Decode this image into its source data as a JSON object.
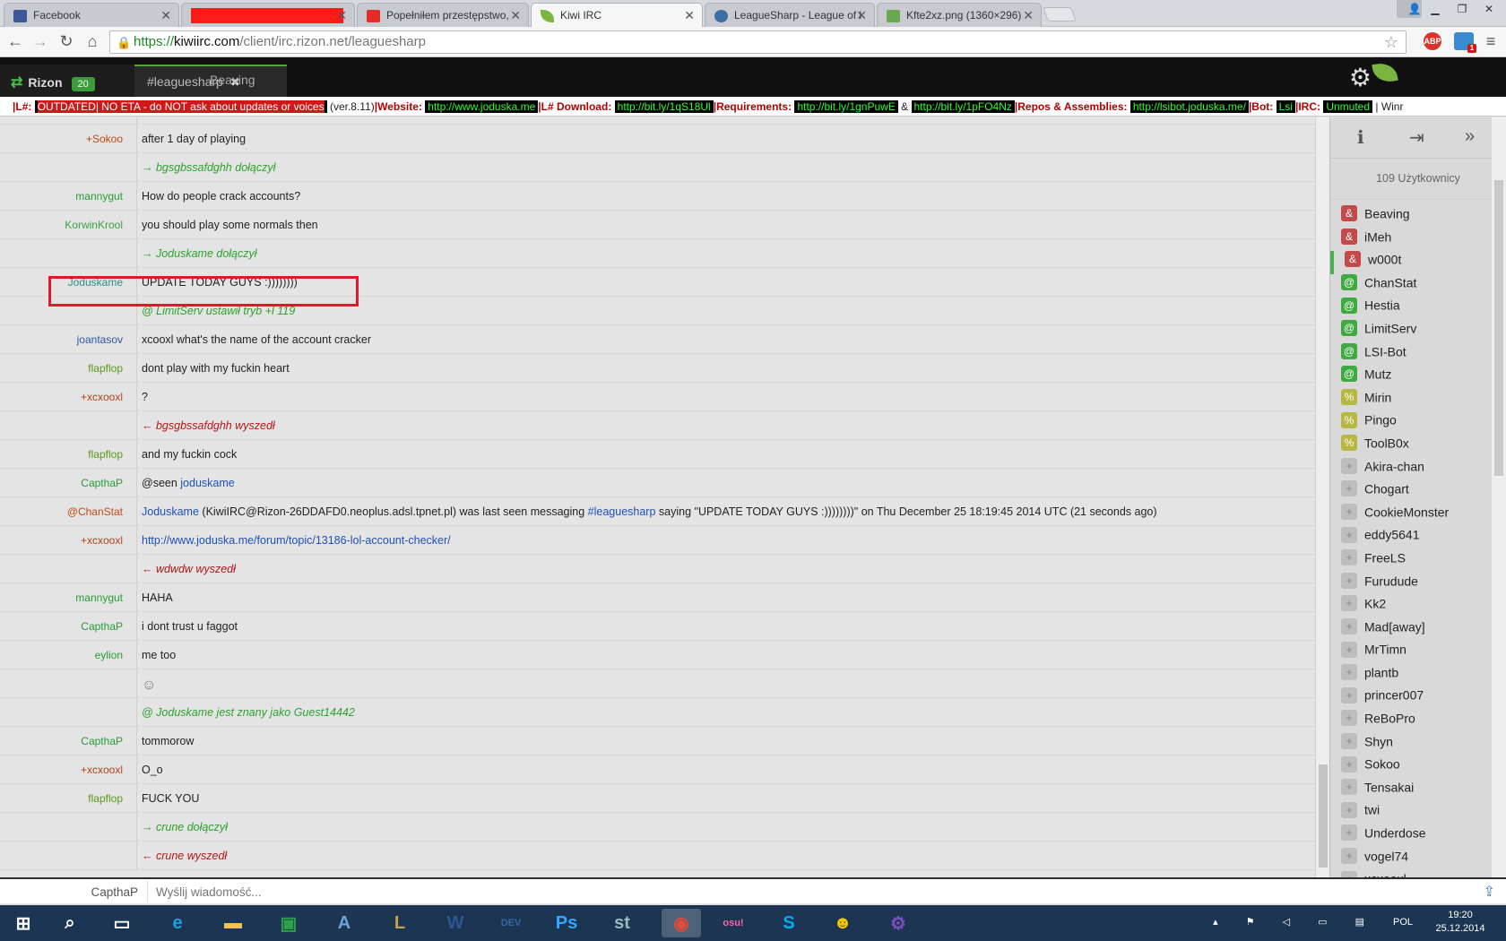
{
  "browser": {
    "tabs": [
      {
        "label": "Facebook",
        "favicon_color": "#3b5998"
      },
      {
        "label": "",
        "favicon_color": "#ff1a1a"
      },
      {
        "label": "Popełniłem przestępstwo,",
        "favicon_color": "#e52d27"
      },
      {
        "label": "Kiwi IRC",
        "favicon_color": "#7ab542"
      },
      {
        "label": "LeagueSharp - League of l",
        "favicon_color": "#3c6ea2"
      },
      {
        "label": "Kfte2xz.png (1360×296)",
        "favicon_color": "#6aa84f"
      }
    ],
    "url_https": "https://",
    "url_host": "kiwiirc.com",
    "url_path": "/client/irc.rizon.net/leaguesharp",
    "ext_abp": "ABP",
    "ext_badge": "1"
  },
  "kiwi": {
    "network": "Rizon",
    "network_badge": "20",
    "channel": "#leaguesharp",
    "query": "Beaving"
  },
  "topic": {
    "prefix": "|L#: ",
    "outdated": "OUTDATED| NO ETA - do NOT ask about updates or voices",
    "version": " (ver.8.11)",
    "website_label": "|Website: ",
    "website": "http://www.joduska.me",
    "download_label": "|L# Download: ",
    "download": "http://bit.ly/1qS18Ul",
    "req_label": "|Requirements: ",
    "req1": "http://bit.ly/1gnPuwE",
    "amp": " & ",
    "req2": "http://bit.ly/1pFO4Nz",
    "repos_label": "|Repos & Assemblies: ",
    "repos": "http://lsibot.joduska.me/",
    "bot_label": "|Bot: ",
    "bot": "Lsi",
    "irc_label": "|IRC: ",
    "irc": "Unmuted",
    "tail": " | Winr"
  },
  "messages": [
    {
      "nick": "",
      "text": "",
      "nick_color": "#c04a14",
      "kind": "normal"
    },
    {
      "nick": "+Sokoo",
      "text": "after 1 day of playing",
      "nick_color": "#c04a14",
      "kind": "normal"
    },
    {
      "nick": "",
      "text": "→ bgsgbssafdghh dołączył",
      "nick_color": "#2ea02e",
      "kind": "join"
    },
    {
      "nick": "mannygut",
      "text": "How do people crack accounts?",
      "nick_color": "#2b9a3b",
      "kind": "normal"
    },
    {
      "nick": "KorwinKrool",
      "text": "you should play some normals then",
      "nick_color": "#3aa24a",
      "kind": "normal"
    },
    {
      "nick": "",
      "text": "→ Joduskame dołączył",
      "nick_color": "#2ea02e",
      "kind": "join"
    },
    {
      "nick": "Joduskame",
      "text": "UPDATE TODAY GUYS :))))))))",
      "nick_color": "#2a8f84",
      "kind": "normal"
    },
    {
      "nick": "",
      "text": "@ LimitServ ustawił tryb +l 119",
      "nick_color": "#2ea02e",
      "kind": "join"
    },
    {
      "nick": "joantasov",
      "text": "xcooxl what's the name of the account cracker",
      "nick_color": "#2e55a8",
      "kind": "normal"
    },
    {
      "nick": "flapflop",
      "text": "dont play with my fuckin heart",
      "nick_color": "#5a9a18",
      "kind": "normal"
    },
    {
      "nick": "+xcxooxl",
      "text": "?",
      "nick_color": "#b0411e",
      "kind": "normal"
    },
    {
      "nick": "",
      "text": "← bgsgbssafdghh wyszedł",
      "nick_color": "#b01818",
      "kind": "part"
    },
    {
      "nick": "flapflop",
      "text": "and my fuckin cock",
      "nick_color": "#5a9a18",
      "kind": "normal"
    },
    {
      "nick": "CapthaP",
      "text": "@seen ",
      "text_link": "joduskame",
      "nick_color": "#2b9a3b",
      "kind": "normal"
    },
    {
      "nick": "@ChanStat",
      "text": "",
      "nick_color": "#c04a14",
      "kind": "chanstat"
    },
    {
      "nick": "+xcxooxl",
      "text": "",
      "text_link": "http://www.joduska.me/forum/topic/13186-lol-account-checker/",
      "nick_color": "#b0411e",
      "kind": "normal"
    },
    {
      "nick": "",
      "text": "← wdwdw wyszedł",
      "nick_color": "#b01818",
      "kind": "part"
    },
    {
      "nick": "mannygut",
      "text": "HAHA",
      "nick_color": "#2b9a3b",
      "kind": "normal"
    },
    {
      "nick": "CapthaP",
      "text": "i dont trust u faggot",
      "nick_color": "#2b9a3b",
      "kind": "normal"
    },
    {
      "nick": "eylion",
      "text": "me too",
      "nick_color": "#2b9a3b",
      "kind": "normal"
    },
    {
      "nick": "",
      "text": "☺",
      "nick_color": "#777",
      "kind": "emoji"
    },
    {
      "nick": "",
      "text": "@ Joduskame jest znany jako Guest14442",
      "nick_color": "#2ea02e",
      "kind": "join"
    },
    {
      "nick": "CapthaP",
      "text": "tommorow",
      "nick_color": "#2b9a3b",
      "kind": "normal"
    },
    {
      "nick": "+xcxooxl",
      "text": "O_o",
      "nick_color": "#b0411e",
      "kind": "normal"
    },
    {
      "nick": "flapflop",
      "text": "FUCK YOU",
      "nick_color": "#5a9a18",
      "kind": "normal"
    },
    {
      "nick": "",
      "text": "→ crune dołączył",
      "nick_color": "#2ea02e",
      "kind": "join"
    },
    {
      "nick": "",
      "text": "← crune wyszedł",
      "nick_color": "#b01818",
      "kind": "part"
    }
  ],
  "chanstat": {
    "nick_link": "Joduskame",
    "middle": " (KiwiIRC@Rizon-26DDAFD0.neoplus.adsl.tpnet.pl) was last seen messaging ",
    "chan_link": "#leaguesharp",
    "end": " saying \"UPDATE TODAY GUYS :))))))))\" on Thu December 25 18:19:45 2014 UTC (21 seconds ago)"
  },
  "sidebar": {
    "user_count": "109 Użytkownicy",
    "users": [
      {
        "mode": "&",
        "name": "Beaving",
        "cls": "owner"
      },
      {
        "mode": "&",
        "name": "iMeh",
        "cls": "owner"
      },
      {
        "mode": "&",
        "name": "w000t",
        "cls": "owner"
      },
      {
        "mode": "@",
        "name": "ChanStat",
        "cls": "op"
      },
      {
        "mode": "@",
        "name": "Hestia",
        "cls": "op"
      },
      {
        "mode": "@",
        "name": "LimitServ",
        "cls": "op"
      },
      {
        "mode": "@",
        "name": "LSI-Bot",
        "cls": "op"
      },
      {
        "mode": "@",
        "name": "Mutz",
        "cls": "op"
      },
      {
        "mode": "%",
        "name": "Mirin",
        "cls": "halfop"
      },
      {
        "mode": "%",
        "name": "Pingo",
        "cls": "halfop"
      },
      {
        "mode": "%",
        "name": "ToolB0x",
        "cls": "halfop"
      },
      {
        "mode": "+",
        "name": "Akira-chan",
        "cls": "voice"
      },
      {
        "mode": "+",
        "name": "Chogart",
        "cls": "voice"
      },
      {
        "mode": "+",
        "name": "CookieMonster",
        "cls": "voice"
      },
      {
        "mode": "+",
        "name": "eddy5641",
        "cls": "voice"
      },
      {
        "mode": "+",
        "name": "FreeLS",
        "cls": "voice"
      },
      {
        "mode": "+",
        "name": "Furudude",
        "cls": "voice"
      },
      {
        "mode": "+",
        "name": "Kk2",
        "cls": "voice"
      },
      {
        "mode": "+",
        "name": "Mad[away]",
        "cls": "voice"
      },
      {
        "mode": "+",
        "name": "MrTimn",
        "cls": "voice"
      },
      {
        "mode": "+",
        "name": "plantb",
        "cls": "voice"
      },
      {
        "mode": "+",
        "name": "princer007",
        "cls": "voice"
      },
      {
        "mode": "+",
        "name": "ReBoPro",
        "cls": "voice"
      },
      {
        "mode": "+",
        "name": "Shyn",
        "cls": "voice"
      },
      {
        "mode": "+",
        "name": "Sokoo",
        "cls": "voice"
      },
      {
        "mode": "+",
        "name": "Tensakai",
        "cls": "voice"
      },
      {
        "mode": "+",
        "name": "twi",
        "cls": "voice"
      },
      {
        "mode": "+",
        "name": "Underdose",
        "cls": "voice"
      },
      {
        "mode": "+",
        "name": "vogel74",
        "cls": "voice"
      },
      {
        "mode": "+",
        "name": "xcxooxl",
        "cls": "voice"
      }
    ]
  },
  "input": {
    "nick": "CapthaP",
    "placeholder": "Wyślij wiadomość..."
  },
  "taskbar": {
    "items": [
      {
        "name": "start-button",
        "glyph": "⊞",
        "color": "#ffffff"
      },
      {
        "name": "search-icon",
        "glyph": "⌕",
        "color": "#ffffff"
      },
      {
        "name": "task-view-icon",
        "glyph": "▭",
        "color": "#ffffff"
      },
      {
        "name": "ie-icon",
        "glyph": "e",
        "color": "#1ba1e2"
      },
      {
        "name": "explorer-icon",
        "glyph": "▬",
        "color": "#f2c14e"
      },
      {
        "name": "store-icon",
        "glyph": "▣",
        "color": "#2ea04a"
      },
      {
        "name": "notepad-icon",
        "glyph": "A",
        "color": "#6aa6d6"
      },
      {
        "name": "league-icon",
        "glyph": "L",
        "color": "#c8a24a"
      },
      {
        "name": "word-icon",
        "glyph": "W",
        "color": "#2b5797"
      },
      {
        "name": "devcpp-icon",
        "glyph": "DEV",
        "color": "#3566a6"
      },
      {
        "name": "photoshop-icon",
        "glyph": "Ps",
        "color": "#31a8ff"
      },
      {
        "name": "sublime-icon",
        "glyph": "st",
        "color": "#9bb"
      },
      {
        "name": "chrome-icon",
        "glyph": "◉",
        "color": "#dd4b39"
      },
      {
        "name": "osu-icon",
        "glyph": "osu!",
        "color": "#ff66aa"
      },
      {
        "name": "skype-icon",
        "glyph": "S",
        "color": "#00aff0"
      },
      {
        "name": "cyberghost-icon",
        "glyph": "☻",
        "color": "#f5c400"
      },
      {
        "name": "settings-icon",
        "glyph": "⚙",
        "color": "#7a4fc2"
      }
    ],
    "lang": "POL",
    "time": "19:20",
    "date": "25.12.2014"
  }
}
